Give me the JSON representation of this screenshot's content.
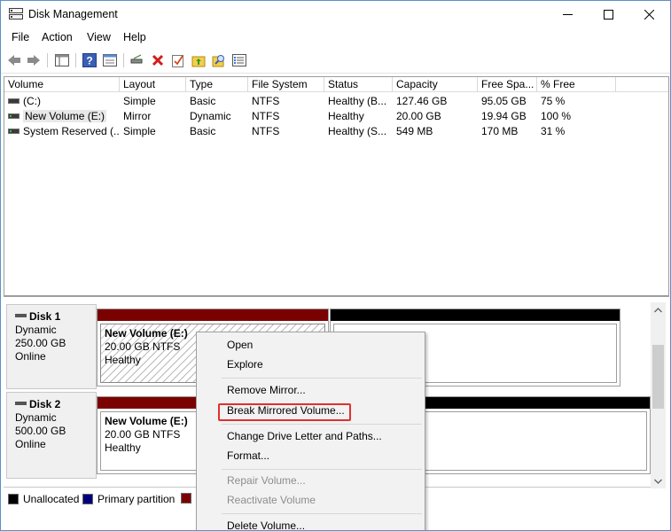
{
  "window": {
    "title": "Disk Management"
  },
  "menu": [
    "File",
    "Action",
    "View",
    "Help"
  ],
  "toolbar_icons": [
    "back-icon",
    "forward-icon",
    "show-hide-console-tree-icon",
    "help-icon",
    "properties-icon",
    "connect-icon",
    "delete-icon",
    "check-icon",
    "folder-up-icon",
    "search-icon",
    "list-icon"
  ],
  "columns": [
    "Volume",
    "Layout",
    "Type",
    "File System",
    "Status",
    "Capacity",
    "Free Spa...",
    "% Free"
  ],
  "volumes": [
    {
      "volume": "(C:)",
      "layout": "Simple",
      "type": "Basic",
      "fs": "NTFS",
      "status": "Healthy (B...",
      "capacity": "127.46 GB",
      "free": "95.05 GB",
      "pct": "75 %"
    },
    {
      "volume": "New Volume (E:)",
      "layout": "Mirror",
      "type": "Dynamic",
      "fs": "NTFS",
      "status": "Healthy",
      "capacity": "20.00 GB",
      "free": "19.94 GB",
      "pct": "100 %"
    },
    {
      "volume": "System Reserved (...",
      "layout": "Simple",
      "type": "Basic",
      "fs": "NTFS",
      "status": "Healthy (S...",
      "capacity": "549 MB",
      "free": "170 MB",
      "pct": "31 %"
    }
  ],
  "disks": [
    {
      "name": "Disk 1",
      "type": "Dynamic",
      "size": "250.00 GB",
      "state": "Online",
      "partition": {
        "name": "New Volume  (E:)",
        "size_fs": "20.00 GB NTFS",
        "status": "Healthy"
      }
    },
    {
      "name": "Disk 2",
      "type": "Dynamic",
      "size": "500.00 GB",
      "state": "Online",
      "partition": {
        "name": "New Volume  (E:)",
        "size_fs": "20.00 GB NTFS",
        "status": "Healthy"
      }
    }
  ],
  "legend": [
    {
      "label": "Unallocated",
      "color": "#000000"
    },
    {
      "label": "Primary partition",
      "color": "#00007b"
    },
    {
      "label": "",
      "color": "#7b0000"
    }
  ],
  "colors": {
    "mirrored_bar": "#7b0000",
    "unallocated_bar": "#000000",
    "highlight": "#e0302f"
  },
  "context_menu": {
    "items": [
      {
        "label": "Open",
        "enabled": true
      },
      {
        "label": "Explore",
        "enabled": true
      },
      {
        "label": "Remove Mirror...",
        "enabled": true
      },
      {
        "label": "Break Mirrored Volume...",
        "enabled": true,
        "highlighted": true
      },
      {
        "label": "Change Drive Letter and Paths...",
        "enabled": true
      },
      {
        "label": "Format...",
        "enabled": true
      },
      {
        "label": "Repair Volume...",
        "enabled": false
      },
      {
        "label": "Reactivate Volume",
        "enabled": false
      },
      {
        "label": "Delete Volume...",
        "enabled": true
      }
    ]
  }
}
